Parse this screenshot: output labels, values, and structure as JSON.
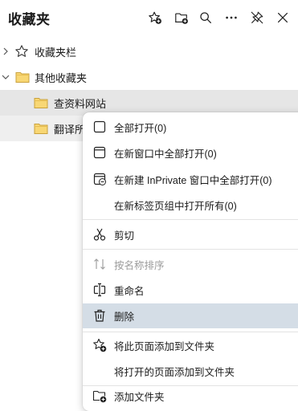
{
  "header": {
    "title": "收藏夹",
    "buttons": [
      "add-favorite-icon",
      "add-folder-icon",
      "search-icon",
      "more-icon",
      "pin-icon",
      "close-icon"
    ]
  },
  "tree": {
    "favorites_bar": "收藏夹栏",
    "other_favorites": "其他收藏夹",
    "item1": "查资料网站",
    "item2": "翻译所"
  },
  "menu": {
    "open_all": "全部打开(0)",
    "open_all_new_window": "在新窗口中全部打开(0)",
    "open_all_inprivate": "在新建 InPrivate 窗口中全部打开(0)",
    "open_all_new_tab_group": "在新标签页组中打开所有(0)",
    "cut": "剪切",
    "sort_by_name": "按名称排序",
    "rename": "重命名",
    "delete": "删除",
    "add_page_to_folder": "将此页面添加到文件夹",
    "add_open_pages_to_folder": "将打开的页面添加到文件夹",
    "add_folder": "添加文件夹"
  }
}
